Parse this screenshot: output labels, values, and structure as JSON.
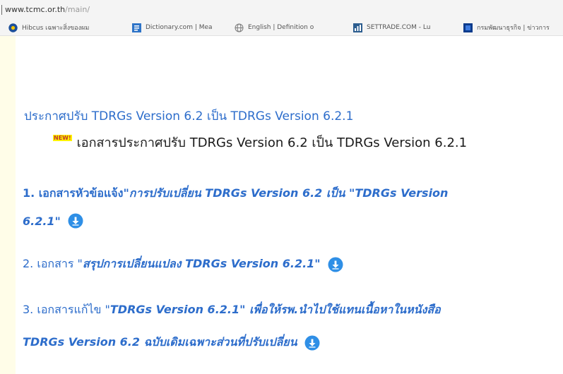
{
  "address_bar": {
    "domain": "www.tcmc.or.th",
    "path": "/main/"
  },
  "bookmarks": [
    {
      "label": "Hibcus เฉพาะสิ่งของผม",
      "icon": "hibiscus-icon"
    },
    {
      "label": "Dictionary.com | Mea",
      "icon": "dictionary-icon"
    },
    {
      "label": "English | Definition o",
      "icon": "globe-icon"
    },
    {
      "label": "SETTRADE.COM - Lu",
      "icon": "settrade-icon"
    },
    {
      "label": "กรมพัฒนาธุรกิจ | ข่าวการ",
      "icon": "bookmark-icon"
    }
  ],
  "announcement": {
    "title": "ประกาศปรับ TDRGs Version 6.2 เป็น TDRGs Version 6.2.1"
  },
  "new_item": {
    "badge": "NEW!",
    "text": "เอกสารประกาศปรับ TDRGs Version 6.2 เป็น TDRGs Version 6.2.1"
  },
  "items": {
    "item1_prefix": "1. เอกสารหัวข้อแจ้ง",
    "item1_quote": "\"การปรับเปลี่ยน TDRGs Version 6.2 เป็น \"TDRGs Version",
    "item1_quote_end": "6.2.1\"",
    "item2_prefix": "2. เอกสาร \"",
    "item2_title": "สรุปการเปลี่ยนแปลง TDRGs Version 6.2.1\"",
    "item3_prefix": "3. เอกสารแก้ไข \"",
    "item3_title": "TDRGs Version 6.2.1\" เพื่อให้รพ.นำไปใช้แทนเนื้อหาในหนังสือ",
    "item3_cont": "TDRGs Version 6.2 ฉบับเดิมเฉพาะส่วนที่ปรับเปลี่ยน"
  },
  "colors": {
    "link_blue": "#2d6dcb",
    "download_blue": "#2f8fe6",
    "margin_yellow": "#fffde8",
    "new_badge_bg": "#fff200",
    "new_badge_text": "#c0392b"
  }
}
